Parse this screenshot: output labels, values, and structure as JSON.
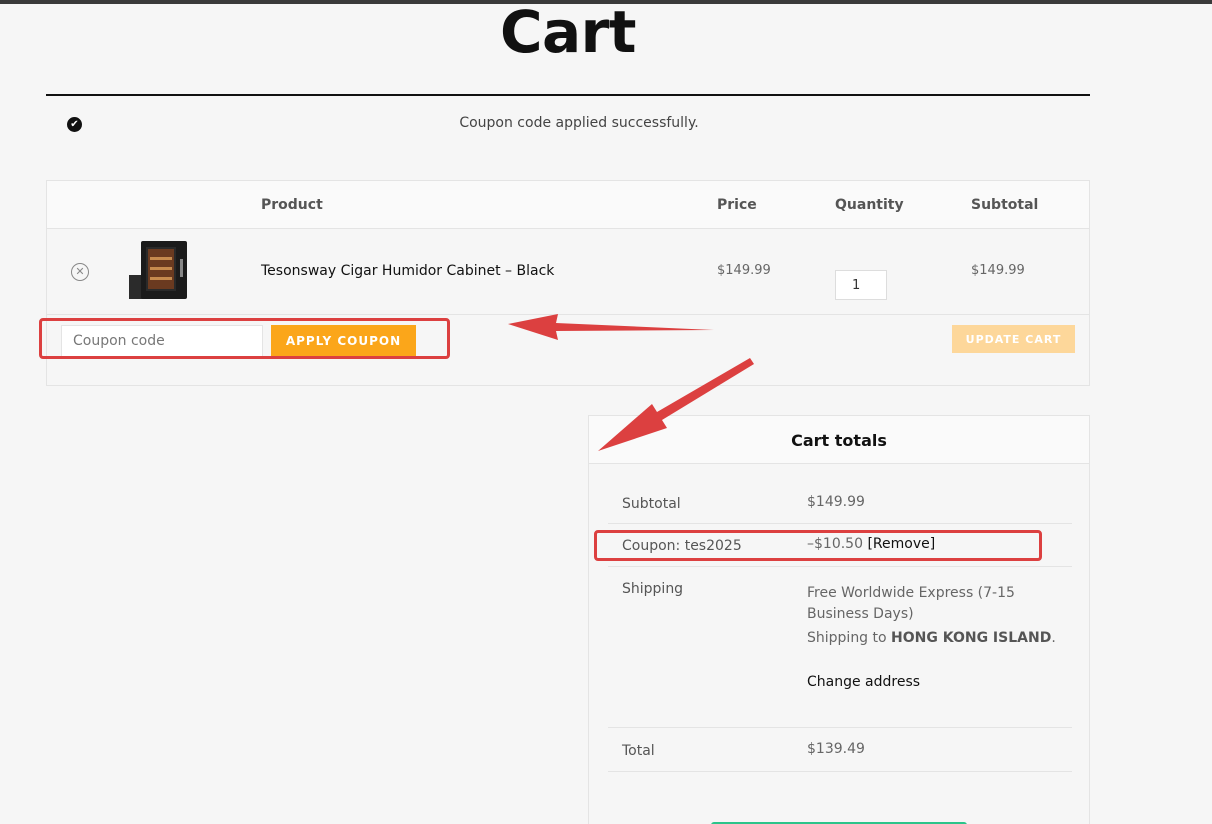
{
  "page": {
    "title": "Cart"
  },
  "notice": {
    "message": "Coupon code applied successfully."
  },
  "cart_table": {
    "headers": {
      "product": "Product",
      "price": "Price",
      "quantity": "Quantity",
      "subtotal": "Subtotal"
    },
    "items": [
      {
        "remove_icon": "close-circle-icon",
        "name": "Tesonsway Cigar Humidor Cabinet – Black",
        "price": "$149.99",
        "quantity": "1",
        "subtotal": "$149.99"
      }
    ]
  },
  "actions": {
    "coupon_placeholder": "Coupon code",
    "apply_label": "APPLY COUPON",
    "update_label": "UPDATE CART"
  },
  "totals": {
    "title": "Cart totals",
    "subtotal_label": "Subtotal",
    "subtotal_value": "$149.99",
    "coupon_label": "Coupon: tes2025",
    "coupon_value": "–$10.50",
    "coupon_remove": "[Remove]",
    "shipping_label": "Shipping",
    "shipping_method": "Free Worldwide Express (7-15 Business Days)",
    "shipping_to_prefix": "Shipping to",
    "shipping_to_region": "HONG KONG ISLAND",
    "shipping_to_suffix": ".",
    "change_address": "Change address",
    "total_label": "Total",
    "total_value": "$139.49"
  },
  "annotation": {
    "color": "#dc4040"
  },
  "colors": {
    "accent": "#fba61a",
    "update_button": "#fdd79a",
    "checkout": "#2bc48a"
  }
}
